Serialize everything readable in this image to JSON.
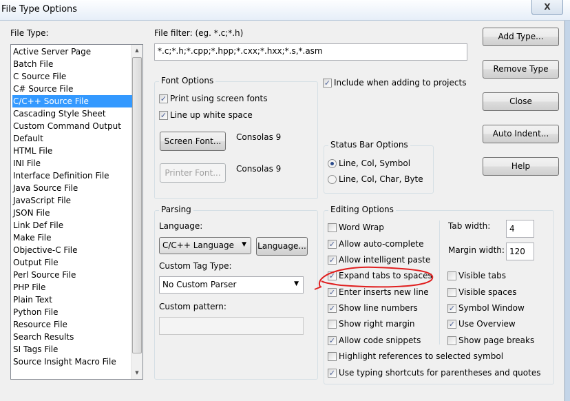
{
  "window": {
    "title": "File Type Options",
    "close": "X"
  },
  "file_type": {
    "label": "File Type:",
    "items": [
      "Active Server Page",
      "Batch File",
      "C Source File",
      "C# Source File",
      "C/C++ Source File",
      "Cascading Style Sheet",
      "Custom Command Output",
      "Default",
      "HTML File",
      "INI File",
      "Interface Definition File",
      "Java Source File",
      "JavaScript File",
      "JSON File",
      "Link Def File",
      "Make File",
      "Objective-C File",
      "Output File",
      "Perl Source File",
      "PHP File",
      "Plain Text",
      "Python File",
      "Resource File",
      "Search Results",
      "SI Tags File",
      "Source Insight Macro File"
    ],
    "selected": "C/C++ Source File"
  },
  "filter": {
    "label": "File filter: (eg. *.c;*.h)",
    "value": "*.c;*.h;*.cpp;*.hpp;*.cxx;*.hxx;*.s,*.asm"
  },
  "buttons": {
    "add": "Add Type...",
    "remove": "Remove Type",
    "close": "Close",
    "auto_indent": "Auto Indent...",
    "help": "Help"
  },
  "font_options": {
    "title": "Font Options",
    "print_screen": "Print using screen fonts",
    "print_screen_checked": true,
    "line_up": "Line up white space",
    "line_up_checked": true,
    "screen_font_btn": "Screen Font...",
    "screen_font": "Consolas 9",
    "printer_font_btn": "Printer Font...",
    "printer_font": "Consolas 9"
  },
  "include_projects": {
    "label": "Include when adding to projects",
    "checked": true
  },
  "status_bar": {
    "title": "Status Bar Options",
    "options": [
      "Line, Col, Symbol",
      "Line, Col, Char, Byte"
    ],
    "selected": "Line, Col, Symbol"
  },
  "parsing": {
    "title": "Parsing",
    "language_label": "Language:",
    "language": "C/C++ Language",
    "language_btn": "Language...",
    "tag_label": "Custom Tag Type:",
    "tag": "No Custom Parser",
    "pattern_label": "Custom pattern:",
    "pattern": ""
  },
  "editing": {
    "title": "Editing Options",
    "left": [
      {
        "label": "Word Wrap",
        "checked": false
      },
      {
        "label": "Allow auto-complete",
        "checked": true
      },
      {
        "label": "Allow intelligent paste",
        "checked": true
      },
      {
        "label": "Expand tabs to spaces",
        "checked": true
      },
      {
        "label": "Enter inserts new line",
        "checked": true
      },
      {
        "label": "Show line numbers",
        "checked": true
      },
      {
        "label": "Show right margin",
        "checked": false
      },
      {
        "label": "Allow code snippets",
        "checked": true
      }
    ],
    "right": [
      {
        "label": "Visible tabs",
        "checked": false
      },
      {
        "label": "Visible spaces",
        "checked": false
      },
      {
        "label": "Symbol Window",
        "checked": true
      },
      {
        "label": "Use Overview",
        "checked": true
      },
      {
        "label": "Show page breaks",
        "checked": false
      }
    ],
    "wide": [
      {
        "label": "Highlight references to selected symbol",
        "checked": false
      },
      {
        "label": "Use typing shortcuts for parentheses and quotes",
        "checked": true
      }
    ],
    "tab_width_label": "Tab width:",
    "tab_width": "4",
    "margin_width_label": "Margin width:",
    "margin_width": "120"
  },
  "annotation_color": "#e02020"
}
